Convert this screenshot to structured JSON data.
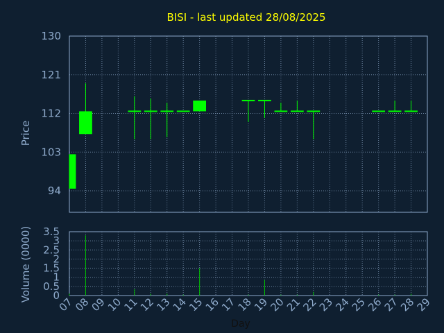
{
  "chart_data": {
    "title": "BISI - last updated 28/08/2025",
    "type": "candlestick",
    "days": [
      "07",
      "08",
      "09",
      "10",
      "11",
      "12",
      "13",
      "14",
      "15",
      "16",
      "17",
      "18",
      "19",
      "20",
      "21",
      "22",
      "23",
      "24",
      "25",
      "26",
      "27",
      "28",
      "29"
    ],
    "xlabel": "Day",
    "price": {
      "ylabel": "Price",
      "yticks": [
        94,
        103,
        112,
        121,
        130
      ],
      "ylim": [
        89,
        130
      ],
      "grid": true,
      "candles": [
        {
          "day": "07",
          "open": 102.5,
          "close": 94.5,
          "high": 102.5,
          "low": 94.5
        },
        {
          "day": "08",
          "open": 112.5,
          "close": 107.2,
          "high": 119.0,
          "low": 107.2
        },
        {
          "day": "11",
          "open": 112.5,
          "close": 112.5,
          "high": 116.0,
          "low": 106.0
        },
        {
          "day": "12",
          "open": 112.5,
          "close": 112.5,
          "high": 115.5,
          "low": 106.0
        },
        {
          "day": "13",
          "open": 112.5,
          "close": 112.5,
          "high": 114.5,
          "low": 106.5
        },
        {
          "day": "14",
          "open": 112.5,
          "close": 112.5,
          "high": 112.5,
          "low": 112.5
        },
        {
          "day": "15",
          "open": 112.5,
          "close": 115.0,
          "high": 115.0,
          "low": 112.5
        },
        {
          "day": "18",
          "open": 115.0,
          "close": 115.0,
          "high": 115.0,
          "low": 110.0
        },
        {
          "day": "19",
          "open": 115.0,
          "close": 115.0,
          "high": 115.0,
          "low": 111.0
        },
        {
          "day": "20",
          "open": 112.5,
          "close": 112.5,
          "high": 114.5,
          "low": 112.5
        },
        {
          "day": "21",
          "open": 112.5,
          "close": 112.5,
          "high": 115.0,
          "low": 112.5
        },
        {
          "day": "22",
          "open": 112.5,
          "close": 112.5,
          "high": 112.5,
          "low": 106.0
        },
        {
          "day": "26",
          "open": 112.5,
          "close": 112.5,
          "high": 112.5,
          "low": 112.5
        },
        {
          "day": "27",
          "open": 112.5,
          "close": 112.5,
          "high": 115.0,
          "low": 112.5
        },
        {
          "day": "28",
          "open": 112.5,
          "close": 112.5,
          "high": 115.0,
          "low": 112.5
        }
      ]
    },
    "volume": {
      "ylabel": "Volume (0000)",
      "yticks": [
        0,
        0.5,
        1,
        1.5,
        2,
        2.5,
        3,
        3.5
      ],
      "ytick_labels": [
        "0",
        "0.5",
        "1",
        "1.5",
        "2",
        "2.5",
        "3",
        "3.5"
      ],
      "ylim": [
        0,
        3.5
      ],
      "grid": true,
      "bars": [
        {
          "day": "07",
          "value": 0.1
        },
        {
          "day": "08",
          "value": 3.3
        },
        {
          "day": "11",
          "value": 0.35
        },
        {
          "day": "12",
          "value": 0.1
        },
        {
          "day": "13",
          "value": 0.1
        },
        {
          "day": "14",
          "value": 0.05
        },
        {
          "day": "15",
          "value": 1.5
        },
        {
          "day": "18",
          "value": 0.05
        },
        {
          "day": "19",
          "value": 0.85
        },
        {
          "day": "20",
          "value": 0.05
        },
        {
          "day": "21",
          "value": 0.05
        },
        {
          "day": "22",
          "value": 0.2
        },
        {
          "day": "26",
          "value": 0.05
        },
        {
          "day": "27",
          "value": 0.05
        },
        {
          "day": "28",
          "value": 0.1
        }
      ]
    },
    "colors": {
      "background": "#0f1f30",
      "candle": "#00ff00",
      "volume_bar": "#00c000",
      "frame": "#8eaacb",
      "grid": "#8eaacb",
      "title": "#ffff00",
      "tick_text": "#8eaacb",
      "xlabel_text": "#101010"
    }
  }
}
